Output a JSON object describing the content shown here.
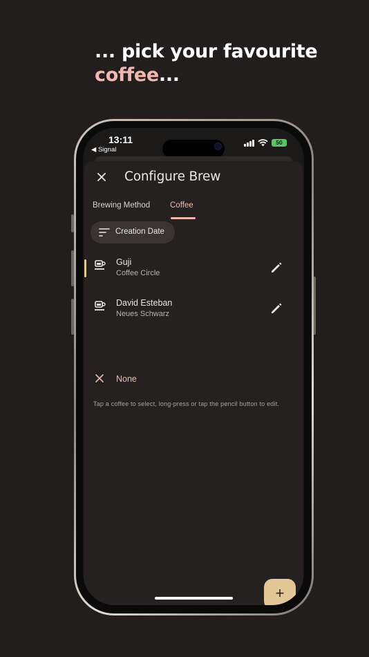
{
  "headline": {
    "line1": "... pick your favourite",
    "accent": "coffee",
    "suffix": "..."
  },
  "status_bar": {
    "time": "13:11",
    "back_app": "◀ Signal",
    "battery": "50"
  },
  "sheet": {
    "title": "Configure Brew",
    "tabs": [
      {
        "label": "Brewing Method",
        "selected": false
      },
      {
        "label": "Coffee",
        "selected": true
      }
    ],
    "sort_chip": "Creation Date",
    "coffees": [
      {
        "name": "Guji",
        "roaster": "Coffee Circle",
        "selected": true
      },
      {
        "name": "David Esteban",
        "roaster": "Neues Schwarz",
        "selected": false
      }
    ],
    "none_label": "None",
    "hint": "Tap a coffee to select, long-press or tap the pencil button to edit.",
    "fab_label": "+"
  },
  "colors": {
    "background": "#221e1e",
    "accent_pink": "#f1b8b0",
    "accent_gold": "#e3c797",
    "battery_green": "#56c763"
  }
}
